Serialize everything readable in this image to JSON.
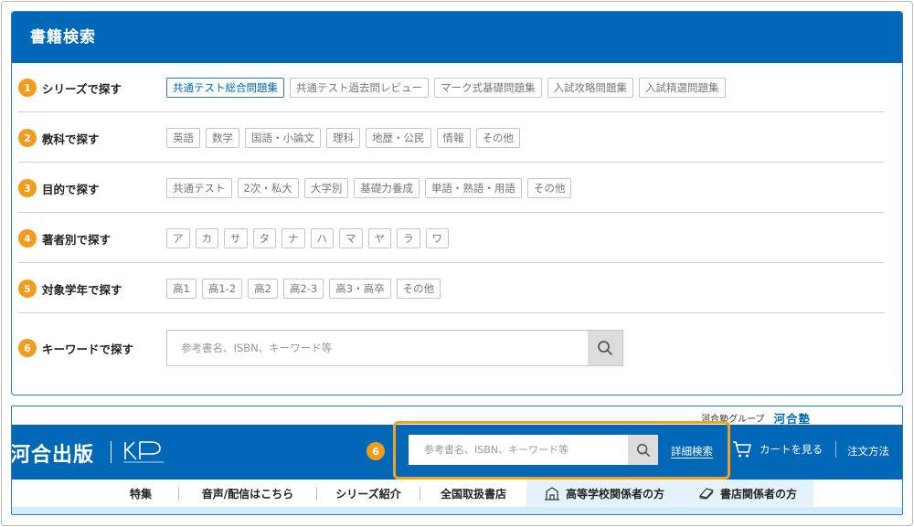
{
  "panel": {
    "title": "書籍検索",
    "rows": [
      {
        "num": "1",
        "label": "シリーズで探す",
        "chips": [
          "共通テスト総合問題集",
          "共通テスト過去問レビュー",
          "マーク式基礎問題集",
          "入試攻略問題集",
          "入試精選問題集"
        ]
      },
      {
        "num": "2",
        "label": "教科で探す",
        "chips": [
          "英語",
          "数学",
          "国語・小論文",
          "理科",
          "地歴・公民",
          "情報",
          "その他"
        ]
      },
      {
        "num": "3",
        "label": "目的で探す",
        "chips": [
          "共通テスト",
          "2次・私大",
          "大学別",
          "基礎力養成",
          "単語・熟語・用語",
          "その他"
        ]
      },
      {
        "num": "4",
        "label": "著者別で探す",
        "chips": [
          "ア",
          "カ",
          "サ",
          "タ",
          "ナ",
          "ハ",
          "マ",
          "ヤ",
          "ラ",
          "ワ"
        ]
      },
      {
        "num": "5",
        "label": "対象学年で探す",
        "chips": [
          "高1",
          "高1-2",
          "高2",
          "高2-3",
          "高3・高卒",
          "その他"
        ]
      },
      {
        "num": "6",
        "label": "キーワードで探す"
      }
    ],
    "keyword_placeholder": "参考書名、ISBN、キーワード等"
  },
  "site": {
    "group_text": "河合塾グループ",
    "group_logo": "河合塾",
    "brand": "河合出版",
    "search_placeholder": "参考書名、ISBN、キーワード等",
    "badge": "6",
    "detail_search": "詳細検索",
    "cart": "カートを見る",
    "order_method": "注文方法",
    "nav": [
      "特集",
      "音声/配信はこちら",
      "シリーズ紹介",
      "全国取扱書店",
      "高等学校関係者の方",
      "書店関係者の方"
    ]
  },
  "colors": {
    "primary": "#0068b7",
    "accent": "#f29b1d",
    "highlight": "#f5a21b"
  }
}
